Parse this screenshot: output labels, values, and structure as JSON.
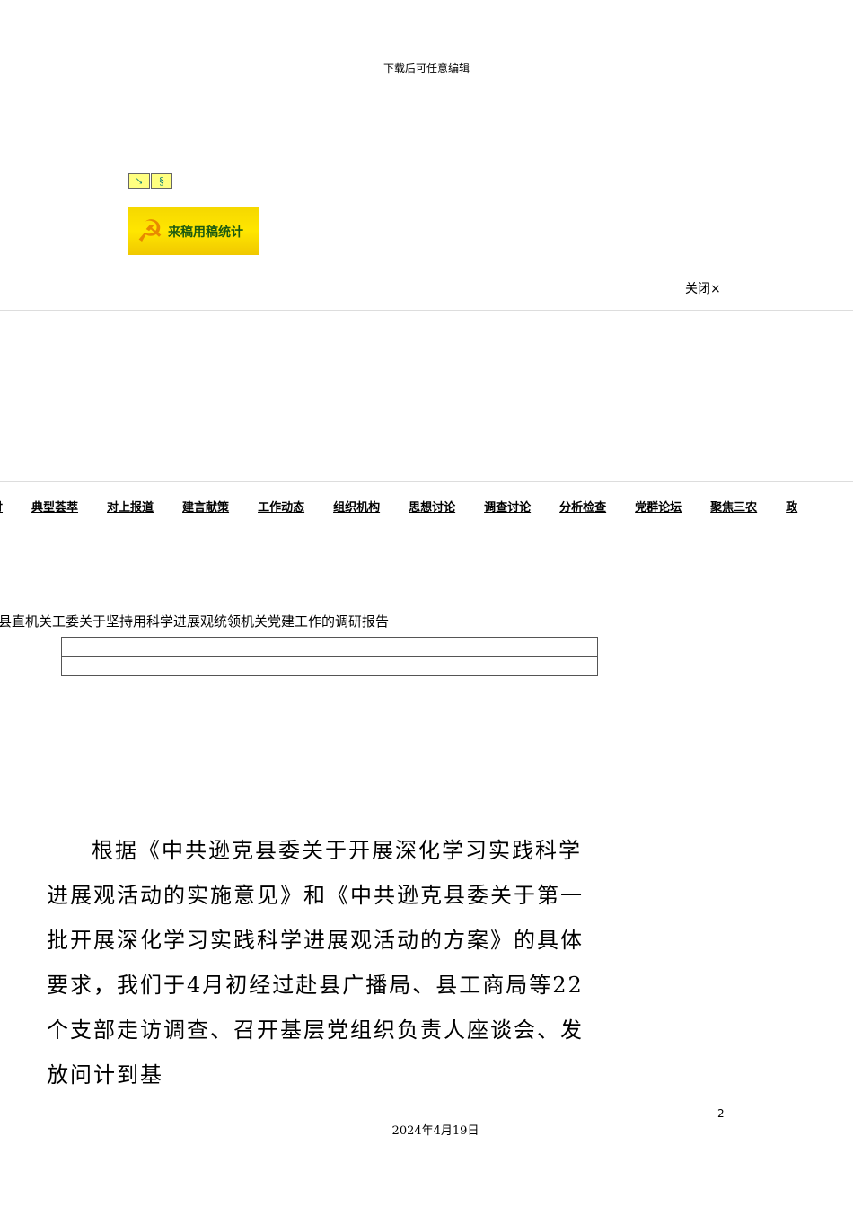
{
  "header": {
    "note": "下载后可任意编辑"
  },
  "banner": {
    "label": "来稿用稿统计"
  },
  "close_label": "关闭×",
  "nav": [
    "讨",
    "典型荟萃",
    "对上报道",
    "建言献策",
    "工作动态",
    "组织机构",
    "思想讨论",
    "调查讨论",
    "分析检查",
    "党群论坛",
    "聚焦三农",
    "政"
  ],
  "article": {
    "title": "县直机关工委关于坚持用科学进展观统领机关党建工作的调研报告",
    "body": "根据《中共逊克县委关于开展深化学习实践科学进展观活动的实施意见》和《中共逊克县委关于第一批开展深化学习实践科学进展观活动的方案》的具体要求，我们于4月初经过赴县广播局、县工商局等22个支部走访调查、召开基层党组织负责人座谈会、发放问计到基"
  },
  "footer": {
    "page_number": "2",
    "date": "2024年4月19日"
  }
}
